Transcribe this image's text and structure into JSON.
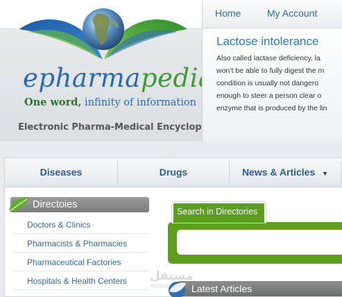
{
  "brand": {
    "logo_pre": "epharma",
    "logo_post": "pedia",
    "tagline_strong": "One word,",
    "tagline_rest": "infinity of information",
    "subtitle": "Electronic Pharma-Medical Encyclopedia",
    "colors": {
      "blue": "#2a6aad",
      "green": "#3f9a3a"
    }
  },
  "top_nav": {
    "items": [
      {
        "label": "Home"
      },
      {
        "label": "My Account"
      }
    ]
  },
  "feature": {
    "title": "Lactose intolerance",
    "lines": [
      "Also called lactase deficiency, la",
      "won’t be able to fully digest the m",
      "condition is usually not dangero",
      "enough to steer a person clear o",
      "enzyme that is produced by the lin"
    ]
  },
  "main_nav": {
    "items": [
      {
        "label": "Diseases"
      },
      {
        "label": "Drugs"
      },
      {
        "label": "News & Articles",
        "has_dropdown": true
      }
    ],
    "accent": "#2c5d93"
  },
  "directories": {
    "title": "Directoies",
    "links": [
      {
        "label": "Doctors & Clinics"
      },
      {
        "label": "Pharmacists & Pharmacies"
      },
      {
        "label": "Pharmaceutical Factories"
      },
      {
        "label": "Hospitals & Health Centers"
      }
    ]
  },
  "search": {
    "tab_label": "Search in Directories",
    "value": "",
    "accent": "#5d9e1f"
  },
  "latest": {
    "title": "Latest Articles"
  },
  "watermark": {
    "arabic": "مستقل",
    "latin": "mostaql.com"
  }
}
